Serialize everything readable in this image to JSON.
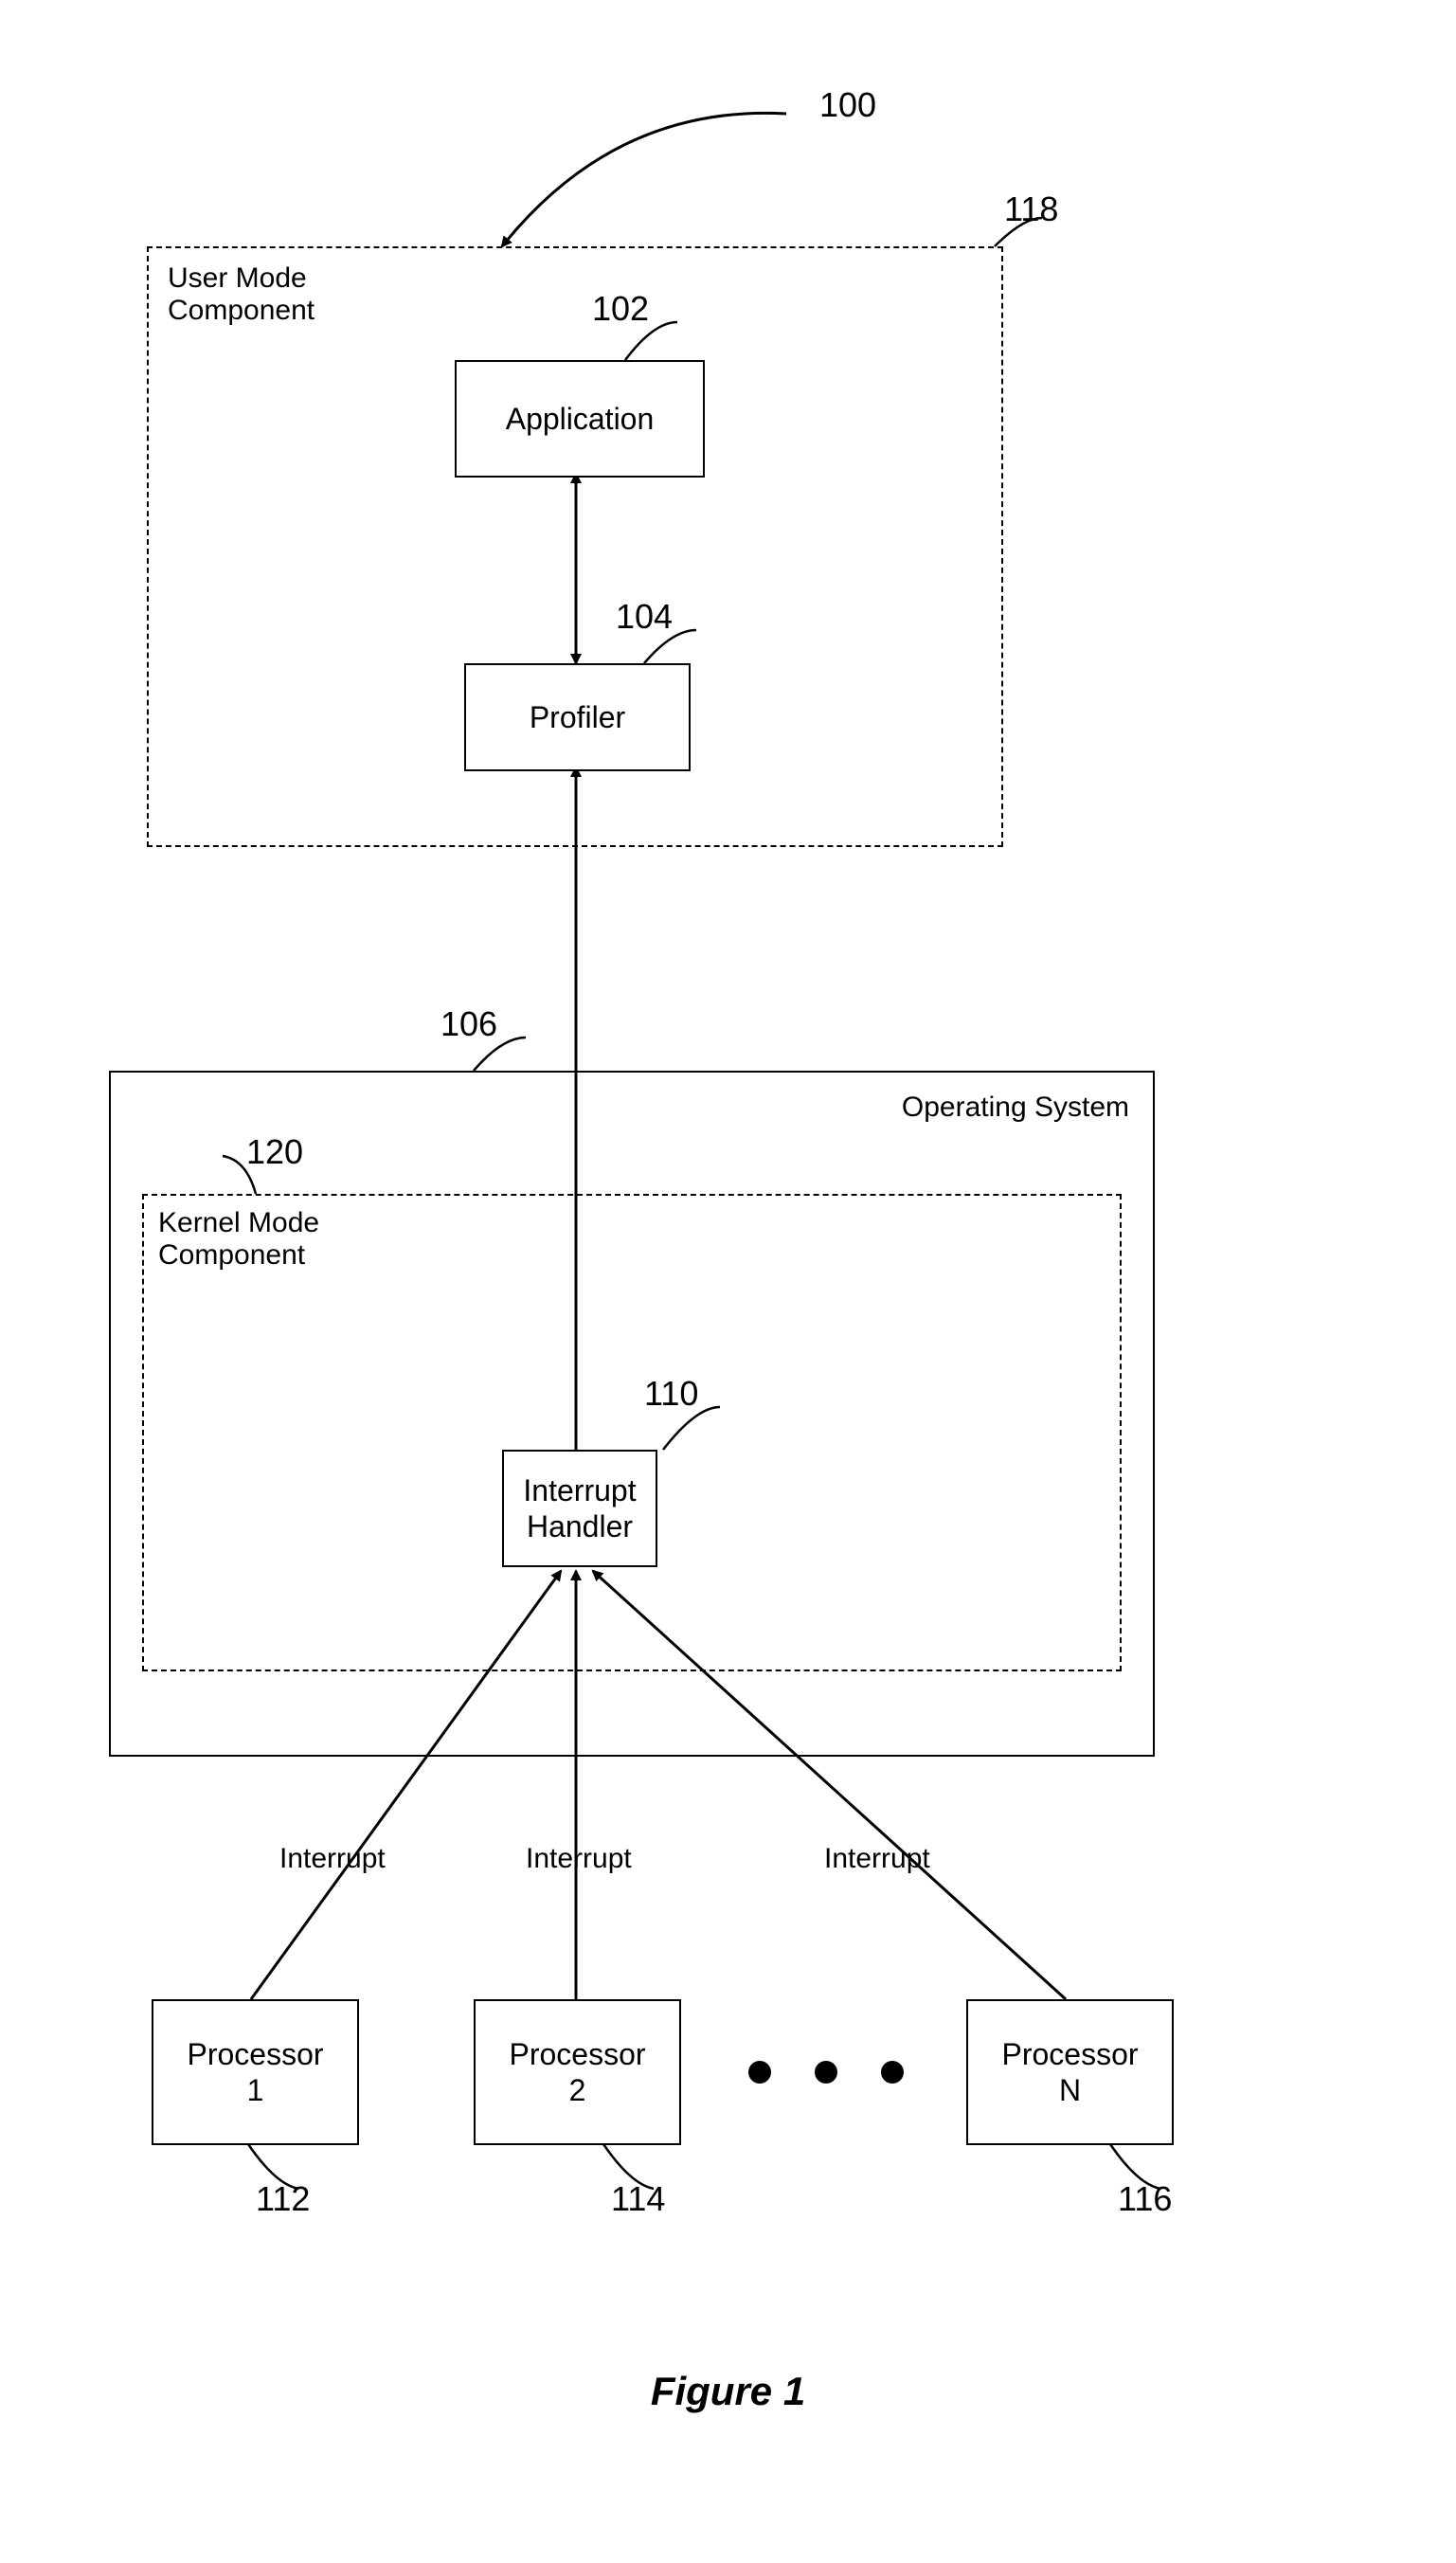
{
  "diagram": {
    "title": "Figure 1",
    "labels": {
      "ref_100": "100",
      "ref_118": "118",
      "ref_102": "102",
      "ref_104": "104",
      "ref_106": "106",
      "ref_120": "120",
      "ref_110": "110",
      "ref_112": "112",
      "ref_114": "114",
      "ref_116": "116",
      "user_mode": "User Mode\nComponent",
      "kernel_mode": "Kernel Mode\nComponent",
      "operating_system": "Operating System",
      "interrupt1": "Interrupt",
      "interrupt2": "Interrupt",
      "interrupt3": "Interrupt"
    },
    "boxes": {
      "application": "Application",
      "profiler": "Profiler",
      "interrupt_handler": "Interrupt\nHandler",
      "processor1": "Processor\n1",
      "processor2": "Processor\n2",
      "processorN": "Processor\nN"
    }
  }
}
